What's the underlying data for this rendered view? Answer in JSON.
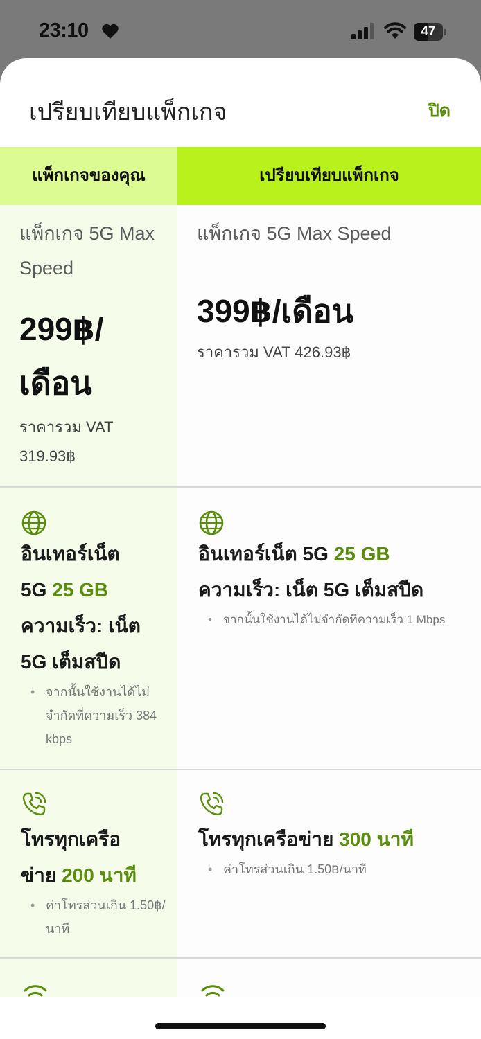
{
  "status_bar": {
    "time": "23:10",
    "battery": "47",
    "battery_level": 0.47
  },
  "sheet": {
    "title": "เปรียบเทียบแพ็กเกจ",
    "close": "ปิด"
  },
  "tabs": {
    "current": "แพ็กเกจของคุณ",
    "compare": "เปรียบเทียบแพ็กเกจ"
  },
  "current_plan": {
    "name_line1": "แพ็กเกจ 5G Max",
    "name_line2": "Speed",
    "price_line1": "299฿/",
    "price_line2": "เดือน",
    "vat_line1": "ราคารวม VAT",
    "vat_line2": "319.93฿",
    "internet": {
      "l1": "อินเทอร์เน็ต",
      "l2_prefix": "5G ",
      "l2_amount": "25 GB",
      "l3": "ความเร็ว: เน็ต",
      "l4": "5G เต็มสปีด",
      "note_l1": "จากนั้นใช้งานได้ไม่",
      "note_l2": "จำกัดที่ความเร็ว 384",
      "note_l3": "kbps"
    },
    "calls": {
      "l1": "โทรทุกเครือ",
      "l2_prefix": "ข่าย ",
      "l2_amount": "200 นาที",
      "note_l1": "ค่าโทรส่วนเกิน 1.50฿/",
      "note_l2": "นาที"
    }
  },
  "compare_plan": {
    "name": "แพ็กเกจ 5G Max Speed",
    "price": "399฿/เดือน",
    "vat": "ราคารวม VAT 426.93฿",
    "internet": {
      "l1_prefix": "อินเทอร์เน็ต 5G ",
      "l1_amount": "25 GB",
      "l2": "ความเร็ว: เน็ต 5G เต็มสปีด",
      "note": "จากนั้นใช้งานได้ไม่จำกัดที่ความเร็ว 1 Mbps"
    },
    "calls": {
      "l1_prefix": "โทรทุกเครือข่าย ",
      "l1_amount": "300 นาที",
      "note": "ค่าโทรส่วนเกิน 1.50฿/นาที"
    }
  },
  "icons": {
    "internet": "globe-icon",
    "calls": "phone-call-icon",
    "wifi": "wifi-icon"
  },
  "colors": {
    "accent": "#b8f11b",
    "accent_light": "#dcfb92",
    "highlight": "#5a8c0e"
  }
}
